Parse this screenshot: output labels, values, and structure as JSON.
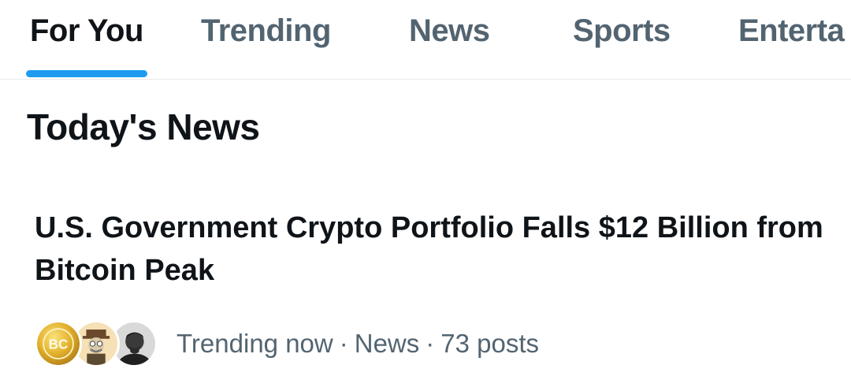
{
  "tabs": [
    {
      "label": "For You",
      "active": true
    },
    {
      "label": "Trending",
      "active": false
    },
    {
      "label": "News",
      "active": false
    },
    {
      "label": "Sports",
      "active": false
    },
    {
      "label": "Enterta",
      "active": false
    }
  ],
  "section": {
    "title": "Today's News"
  },
  "story": {
    "headline": "U.S. Government Crypto Portfolio Falls $12 Billion from Bitcoin Peak",
    "avatars": [
      {
        "name": "bc-coin-avatar",
        "text": "BC"
      },
      {
        "name": "cartoon-character-avatar"
      },
      {
        "name": "person-photo-avatar"
      }
    ],
    "meta": {
      "status": "Trending now",
      "category": "News",
      "posts": "73 posts",
      "separator": "·"
    }
  },
  "colors": {
    "accent": "#1d9bf0",
    "text_primary": "#0f1419",
    "text_secondary": "#536471",
    "divider": "#e6e8ea"
  }
}
